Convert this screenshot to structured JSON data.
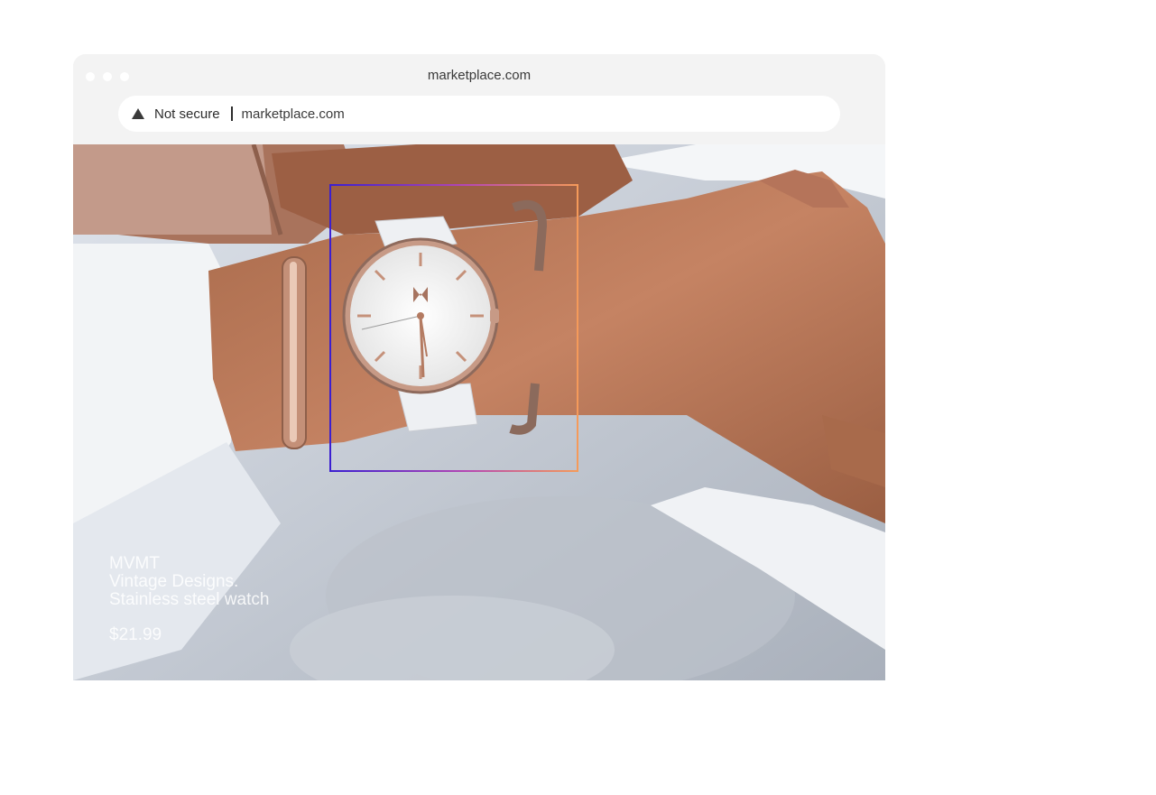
{
  "window": {
    "title": "marketplace.com",
    "traffic_lights": [
      "close",
      "minimize",
      "maximize"
    ]
  },
  "addressbar": {
    "security_icon": "warning-triangle-icon",
    "security_label": "Not secure",
    "url": "marketplace.com"
  },
  "product": {
    "brand": "MVMT",
    "line1": "Vintage Designs.",
    "line2": "Stainless steel watch",
    "price": "$21.99"
  },
  "colors": {
    "chrome_bg": "#f3f3f3",
    "selection_gradient_start": "#3b1fd1",
    "selection_gradient_end": "#f59a5a"
  }
}
